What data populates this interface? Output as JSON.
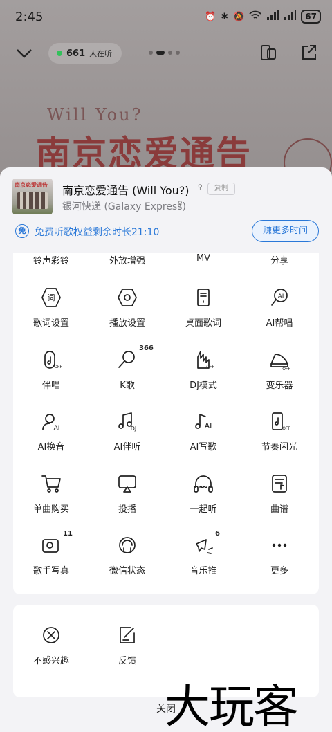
{
  "status_bar": {
    "time": "2:45",
    "battery": "67"
  },
  "top": {
    "listeners_count": "661",
    "listeners_suffix": "人在听"
  },
  "poster": {
    "subtitle": "Will You?",
    "title": "南京恋爱通告"
  },
  "song": {
    "cover_text": "南京恋爱通告",
    "title": "南京恋爱通告 (Will You?)",
    "copy_label": "复制",
    "artist": "银河快递 (Galaxy Express)"
  },
  "free_bar": {
    "icon_label": "免",
    "text": "免费听歌权益剩余时长21:10",
    "earn_label": "赚更多时间"
  },
  "menu_partial": [
    {
      "label": "铃声彩铃"
    },
    {
      "label": "外放增强"
    },
    {
      "label": "MV"
    },
    {
      "label": "分享"
    }
  ],
  "menu": [
    {
      "label": "歌词设置",
      "icon": "lyrics-settings-icon"
    },
    {
      "label": "播放设置",
      "icon": "play-settings-icon"
    },
    {
      "label": "桌面歌词",
      "icon": "desktop-lyrics-icon"
    },
    {
      "label": "AI帮唱",
      "icon": "ai-sing-icon"
    },
    {
      "label": "伴唱",
      "icon": "accompaniment-icon"
    },
    {
      "label": "K歌",
      "icon": "karaoke-icon",
      "badge": "366"
    },
    {
      "label": "DJ模式",
      "icon": "dj-mode-icon"
    },
    {
      "label": "变乐器",
      "icon": "instrument-icon"
    },
    {
      "label": "AI换音",
      "icon": "ai-voice-icon"
    },
    {
      "label": "AI伴听",
      "icon": "ai-listen-icon"
    },
    {
      "label": "AI写歌",
      "icon": "ai-write-icon"
    },
    {
      "label": "节奏闪光",
      "icon": "rhythm-flash-icon"
    },
    {
      "label": "单曲购买",
      "icon": "cart-icon"
    },
    {
      "label": "投播",
      "icon": "cast-icon"
    },
    {
      "label": "一起听",
      "icon": "listen-together-icon"
    },
    {
      "label": "曲谱",
      "icon": "score-icon"
    },
    {
      "label": "歌手写真",
      "icon": "artist-photo-icon",
      "badge": "11"
    },
    {
      "label": "微信状态",
      "icon": "wechat-status-icon"
    },
    {
      "label": "音乐推",
      "icon": "music-push-icon",
      "badge": "6"
    },
    {
      "label": "更多",
      "icon": "more-icon"
    }
  ],
  "secondary": [
    {
      "label": "不感兴趣",
      "icon": "not-interested-icon"
    },
    {
      "label": "反馈",
      "icon": "feedback-icon"
    }
  ],
  "close_label": "关闭",
  "watermark": "大玩客",
  "colors": {
    "accent": "#2a78d8",
    "sheet_bg": "#f3f3f6",
    "listen_dot": "#33c15b"
  }
}
